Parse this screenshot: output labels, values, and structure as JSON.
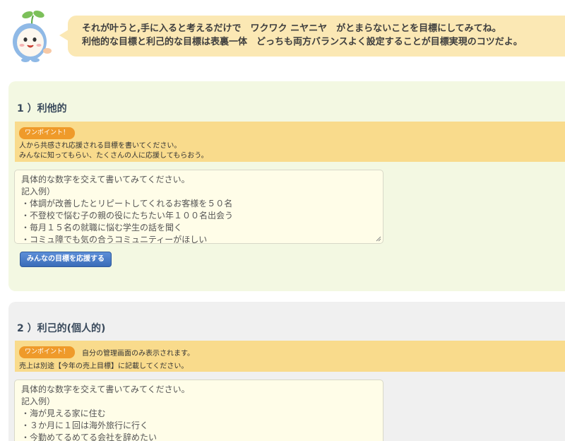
{
  "mascot": {
    "icon": "sprout-mascot-icon"
  },
  "bubble": {
    "line1": "それが叶うと,手に入ると考えるだけで　ワクワク ニヤニヤ　がとまらないことを目標にしてみてね。",
    "line2": "利他的な目標と利己的な目標は表裏一体　どっちも両方バランスよく設定することが目標実現のコツだよ。"
  },
  "section1": {
    "title": "1 ）利他的",
    "badge": "ワンポイント！",
    "hint_lines": [
      "人から共感され応援される目標を書いてください。",
      "みんなに知ってもらい、たくさんの人に応援してもらおう。"
    ],
    "placeholder_lines": [
      "具体的な数字を交えて書いてみてください。",
      "記入例）",
      "・体調が改善したとリピートしてくれるお客様を５０名",
      "・不登校で悩む子の親の役にたちたい年１００名出会う",
      "・毎月１５名の就職に悩む学生の話を聞く",
      "・コミュ障でも気の合うコミュニティーがほしい"
    ],
    "button_label": "みんなの目標を応援する"
  },
  "section2": {
    "title": "2 ）利己的(個人的)",
    "badge": "ワンポイント！",
    "badge_note": "自分の管理画面のみ表示されます。",
    "hint_lines": [
      "売上は別途【今年の売上目標】に記載してください。"
    ],
    "placeholder_lines": [
      "具体的な数字を交えて書いてみてください。",
      "記入例）",
      "・海が見える家に住む",
      "・３か月に１回は海外旅行に行く",
      "・今勤めてるめてる会社を辞めたい"
    ]
  },
  "colors": {
    "bubble": "#fbe8b4",
    "section1_bg": "#f3f8e2",
    "section2_bg": "#f0f0f0",
    "onepoint_bg": "#f9db8c",
    "badge": "#ef9a2a",
    "button": "#3a6cb8"
  }
}
